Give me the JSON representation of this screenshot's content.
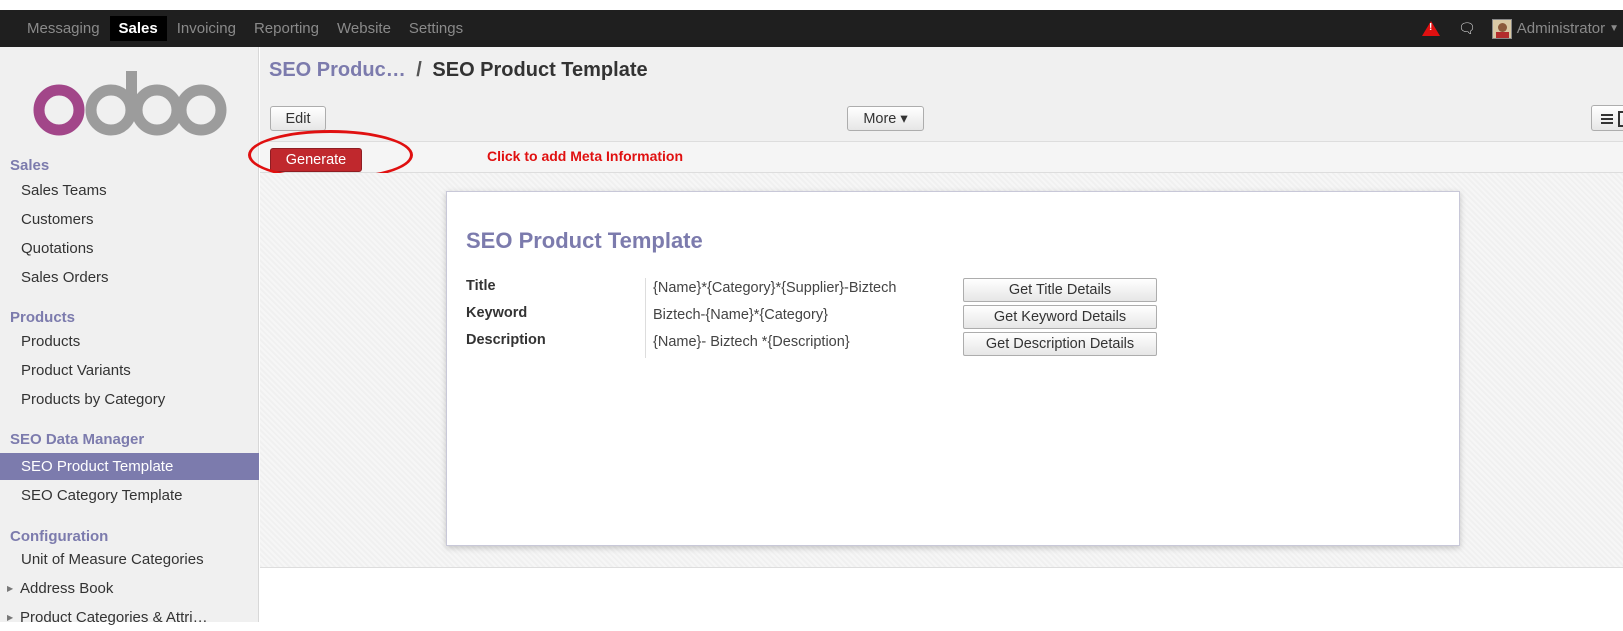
{
  "topbar": {
    "menu": [
      "Messaging",
      "Sales",
      "Invoicing",
      "Reporting",
      "Website",
      "Settings"
    ],
    "active_index": 1,
    "user": "Administrator",
    "icons": [
      "warning-icon",
      "chat-icon",
      "avatar"
    ]
  },
  "sidebar": {
    "logo_text": "odoo",
    "sections": [
      {
        "title": "Sales",
        "items": [
          "Sales Teams",
          "Customers",
          "Quotations",
          "Sales Orders"
        ]
      },
      {
        "title": "Products",
        "items": [
          "Products",
          "Product Variants",
          "Products by Category"
        ]
      },
      {
        "title": "SEO Data Manager",
        "items": [
          "SEO Product Template",
          "SEO Category Template"
        ]
      },
      {
        "title": "Configuration",
        "items": [
          "Unit of Measure Categories",
          "Address Book",
          "Product Categories & Attri…"
        ]
      }
    ],
    "active_item": "SEO Product Template"
  },
  "breadcrumb": {
    "parent": "SEO Produc…",
    "separator": "/",
    "current": "SEO Product Template"
  },
  "toolbar": {
    "edit_label": "Edit",
    "more_label": "More ▾"
  },
  "statusbar": {
    "generate_label": "Generate",
    "callout": "Click to add Meta Information"
  },
  "form": {
    "title": "SEO Product Template",
    "fields": [
      {
        "label": "Title",
        "value": "{Name}*{Category}*{Supplier}-Biztech",
        "button": "Get Title Details"
      },
      {
        "label": "Keyword",
        "value": "Biztech-{Name}*{Category}",
        "button": "Get Keyword Details"
      },
      {
        "label": "Description",
        "value": "{Name}- Biztech *{Description}",
        "button": "Get Description Details"
      }
    ]
  },
  "colors": {
    "brand": "#7c7bad",
    "topbar": "#1f1f1f",
    "danger": "#c0282d",
    "annotation": "#e01010"
  }
}
